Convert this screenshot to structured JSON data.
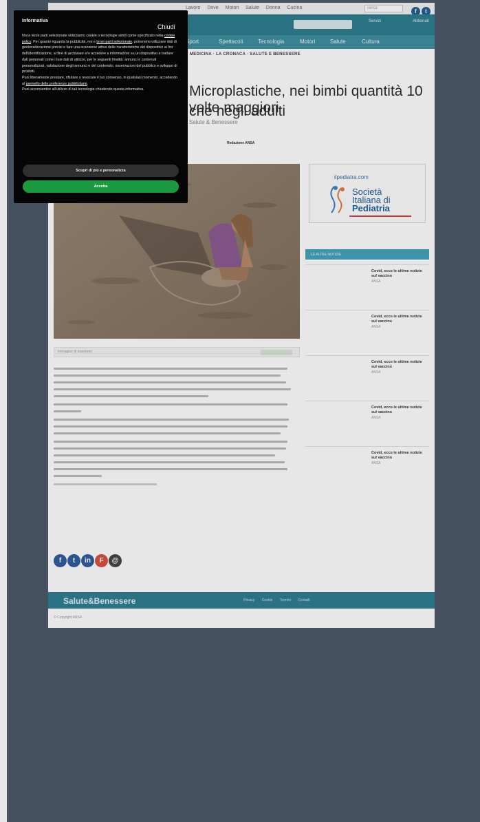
{
  "top_bar": {
    "links": [
      "Lavoro",
      "Dove",
      "Motori",
      "Salute",
      "Donna",
      "Cucina"
    ],
    "search_placeholder": "cerca"
  },
  "masthead": {
    "button_1": "Servizi",
    "button_2": "Abbonati"
  },
  "nav": {
    "items": [
      "Sport",
      "Spettacoli",
      "Tecnologia",
      "Motori",
      "Salute",
      "Cultura"
    ]
  },
  "breadcrumb": "MEDICINA · LA CRONACA · SALUTE E BENESSERE",
  "article": {
    "headline_1": "Microplastiche, nei bimbi quantità 10 volte maggiori",
    "headline_2": "che negli adulti",
    "author": "Salute & Benessere",
    "meta": "Redazione ANSA",
    "image_caption": "Immagine di repertorio"
  },
  "sidebar": {
    "ad": {
      "url": "ilpediatra.com",
      "name_1": "Società",
      "name_2": "Italiana di",
      "name_3": "Pediatria"
    },
    "section_title": "LE ALTRE NOTIZIE",
    "items": [
      {
        "title": "Covid, ecco le ultime notizie sul vaccino",
        "source": "ANSA"
      },
      {
        "title": "Covid, ecco le ultime notizie sul vaccino",
        "source": "ANSA"
      },
      {
        "title": "Covid, ecco le ultime notizie sul vaccino",
        "source": "ANSA"
      },
      {
        "title": "Covid, ecco le ultime notizie sul vaccino",
        "source": "ANSA"
      },
      {
        "title": "Covid, ecco le ultime notizie sul vaccino",
        "source": "ANSA"
      }
    ]
  },
  "footer": {
    "logo": "Salute&Benessere",
    "links": [
      "Privacy",
      "Cookie",
      "Termini",
      "Contatti"
    ],
    "copyright": "© Copyright ANSA"
  },
  "cookie_banner": {
    "title": "Informativa",
    "close_label": "Chiudi",
    "body_1": "Noi e terze parti selezionate utilizziamo cookie o tecnologie simili come specificato nella ",
    "link_cookie_policy": "cookie policy",
    "body_2": ". Per quanto riguarda la pubblicità, noi e ",
    "link_third_parties": "terze parti selezionate",
    "body_3": ", potremmo utilizzare dati di geolocalizzazione precisi e fare una scansione attiva delle caratteristiche del dispositivo ai fini dell'identificazione, al fine di archiviare e/o accedere a informazioni su un dispositivo e trattare dati personali come i tuoi dati di utilizzo, per le seguenti finalità: annunci e contenuti personalizzati, valutazione degli annunci e del contenuto, osservazioni del pubblico e sviluppo di prodotti.",
    "body_4": "Puoi liberamente prestare, rifiutare o revocare il tuo consenso, in qualsiasi momento, accedendo al ",
    "link_preferences": "pannello delle preferenze pubblicitarie",
    "body_5": ".",
    "body_6": "Puoi acconsentire all'utilizzo di tali tecnologie chiudendo questa informativa.",
    "btn_customize": "Scopri di più e personalizza",
    "btn_accept": "Accetta"
  }
}
